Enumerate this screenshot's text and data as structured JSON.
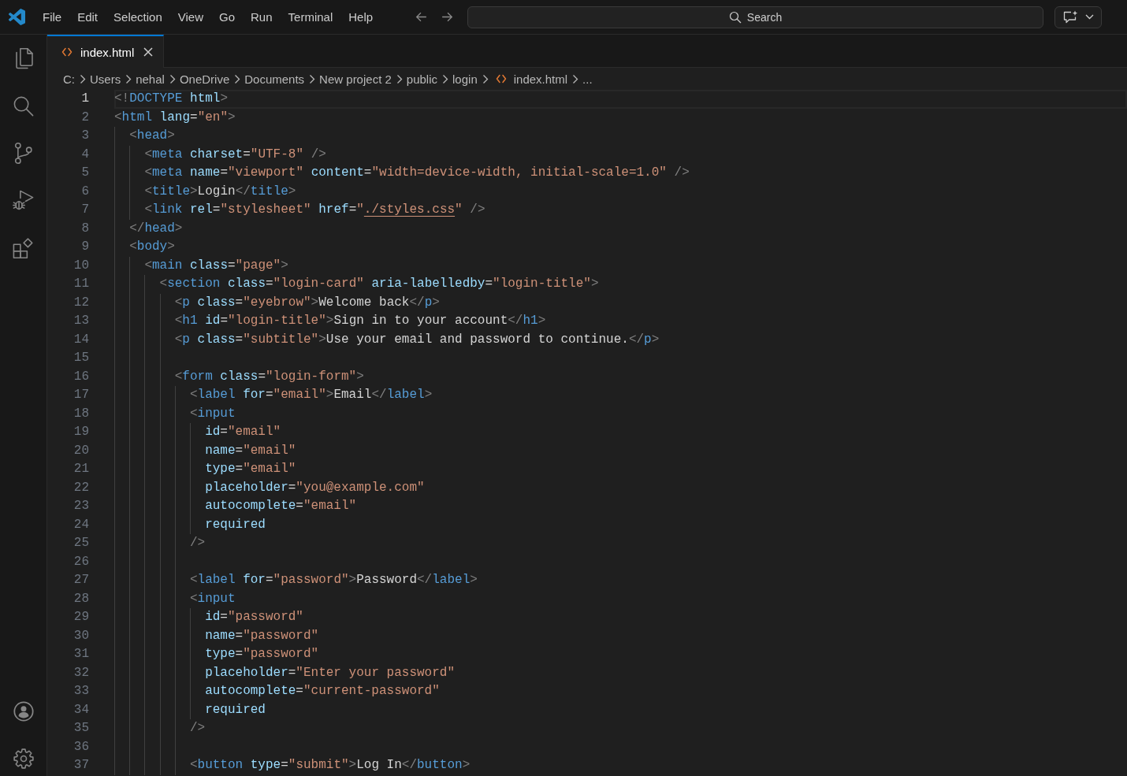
{
  "title_bar": {
    "menu": [
      "File",
      "Edit",
      "Selection",
      "View",
      "Go",
      "Run",
      "Terminal",
      "Help"
    ],
    "command_center": {
      "label": "Search"
    }
  },
  "tabs": [
    {
      "label": "index.html",
      "selected": true
    }
  ],
  "breadcrumb": [
    {
      "label": "C:",
      "kind": "folder"
    },
    {
      "label": "Users",
      "kind": "folder"
    },
    {
      "label": "nehal",
      "kind": "folder"
    },
    {
      "label": "OneDrive",
      "kind": "folder"
    },
    {
      "label": "Documents",
      "kind": "folder"
    },
    {
      "label": "New project 2",
      "kind": "folder"
    },
    {
      "label": "public",
      "kind": "folder"
    },
    {
      "label": "login",
      "kind": "folder"
    },
    {
      "label": "index.html",
      "kind": "file"
    },
    {
      "label": "...",
      "kind": "more"
    }
  ],
  "editor": {
    "lines": [
      {
        "number": "1",
        "current": true,
        "tokens": [
          {
            "kind": "punct",
            "text": "<!"
          },
          {
            "kind": "tag",
            "text": "DOCTYPE"
          },
          {
            "kind": "attr",
            "text": " html"
          },
          {
            "kind": "punct",
            "text": ">"
          }
        ]
      },
      {
        "number": "2",
        "current": false,
        "tokens": [
          {
            "kind": "punct",
            "text": "<"
          },
          {
            "kind": "tag",
            "text": "html"
          },
          {
            "kind": "attr",
            "text": " lang"
          },
          {
            "kind": "op",
            "text": "="
          },
          {
            "kind": "string",
            "text": "\"en\""
          },
          {
            "kind": "punct",
            "text": ">"
          }
        ],
        "children": [
          {
            "number": "3",
            "current": false,
            "tokens": [
              {
                "kind": "punct",
                "text": "<"
              },
              {
                "kind": "tag",
                "text": "head"
              },
              {
                "kind": "punct",
                "text": ">"
              }
            ],
            "children": [
              {
                "number": "4",
                "current": false,
                "tokens": [
                  {
                    "kind": "punct",
                    "text": "<"
                  },
                  {
                    "kind": "tag",
                    "text": "meta"
                  },
                  {
                    "kind": "attr",
                    "text": " charset"
                  },
                  {
                    "kind": "op",
                    "text": "="
                  },
                  {
                    "kind": "string",
                    "text": "\"UTF-8\""
                  },
                  {
                    "kind": "punct",
                    "text": " />"
                  }
                ]
              },
              {
                "number": "5",
                "current": false,
                "tokens": [
                  {
                    "kind": "punct",
                    "text": "<"
                  },
                  {
                    "kind": "tag",
                    "text": "meta"
                  },
                  {
                    "kind": "attr",
                    "text": " name"
                  },
                  {
                    "kind": "op",
                    "text": "="
                  },
                  {
                    "kind": "string",
                    "text": "\"viewport\""
                  },
                  {
                    "kind": "attr",
                    "text": " content"
                  },
                  {
                    "kind": "op",
                    "text": "="
                  },
                  {
                    "kind": "string",
                    "text": "\"width=device-width, initial-scale=1.0\""
                  },
                  {
                    "kind": "punct",
                    "text": " />"
                  }
                ]
              },
              {
                "number": "6",
                "current": false,
                "tokens": [
                  {
                    "kind": "punct",
                    "text": "<"
                  },
                  {
                    "kind": "tag",
                    "text": "title"
                  },
                  {
                    "kind": "punct",
                    "text": ">"
                  },
                  {
                    "kind": "text",
                    "text": "Login"
                  },
                  {
                    "kind": "punct",
                    "text": "</"
                  },
                  {
                    "kind": "tag",
                    "text": "title"
                  },
                  {
                    "kind": "punct",
                    "text": ">"
                  }
                ]
              },
              {
                "number": "7",
                "current": false,
                "tokens": [
                  {
                    "kind": "punct",
                    "text": "<"
                  },
                  {
                    "kind": "tag",
                    "text": "link"
                  },
                  {
                    "kind": "attr",
                    "text": " rel"
                  },
                  {
                    "kind": "op",
                    "text": "="
                  },
                  {
                    "kind": "string",
                    "text": "\"stylesheet\""
                  },
                  {
                    "kind": "attr",
                    "text": " href"
                  },
                  {
                    "kind": "op",
                    "text": "="
                  },
                  {
                    "kind": "string",
                    "text": "\""
                  },
                  {
                    "kind": "link",
                    "text": "./styles.css"
                  },
                  {
                    "kind": "string",
                    "text": "\""
                  },
                  {
                    "kind": "punct",
                    "text": " />"
                  }
                ]
              }
            ]
          },
          {
            "number": "8",
            "current": false,
            "tokens": [
              {
                "kind": "punct",
                "text": "</"
              },
              {
                "kind": "tag",
                "text": "head"
              },
              {
                "kind": "punct",
                "text": ">"
              }
            ]
          },
          {
            "number": "9",
            "current": false,
            "tokens": [
              {
                "kind": "punct",
                "text": "<"
              },
              {
                "kind": "tag",
                "text": "body"
              },
              {
                "kind": "punct",
                "text": ">"
              }
            ],
            "children": [
              {
                "number": "10",
                "current": false,
                "tokens": [
                  {
                    "kind": "punct",
                    "text": "<"
                  },
                  {
                    "kind": "tag",
                    "text": "main"
                  },
                  {
                    "kind": "attr",
                    "text": " class"
                  },
                  {
                    "kind": "op",
                    "text": "="
                  },
                  {
                    "kind": "string",
                    "text": "\"page\""
                  },
                  {
                    "kind": "punct",
                    "text": ">"
                  }
                ],
                "children": [
                  {
                    "number": "11",
                    "current": false,
                    "tokens": [
                      {
                        "kind": "punct",
                        "text": "<"
                      },
                      {
                        "kind": "tag",
                        "text": "section"
                      },
                      {
                        "kind": "attr",
                        "text": " class"
                      },
                      {
                        "kind": "op",
                        "text": "="
                      },
                      {
                        "kind": "string",
                        "text": "\"login-card\""
                      },
                      {
                        "kind": "attr",
                        "text": " aria-labelledby"
                      },
                      {
                        "kind": "op",
                        "text": "="
                      },
                      {
                        "kind": "string",
                        "text": "\"login-title\""
                      },
                      {
                        "kind": "punct",
                        "text": ">"
                      }
                    ],
                    "children": [
                      {
                        "number": "12",
                        "current": false,
                        "tokens": [
                          {
                            "kind": "punct",
                            "text": "<"
                          },
                          {
                            "kind": "tag",
                            "text": "p"
                          },
                          {
                            "kind": "attr",
                            "text": " class"
                          },
                          {
                            "kind": "op",
                            "text": "="
                          },
                          {
                            "kind": "string",
                            "text": "\"eyebrow\""
                          },
                          {
                            "kind": "punct",
                            "text": ">"
                          },
                          {
                            "kind": "text",
                            "text": "Welcome back"
                          },
                          {
                            "kind": "punct",
                            "text": "</"
                          },
                          {
                            "kind": "tag",
                            "text": "p"
                          },
                          {
                            "kind": "punct",
                            "text": ">"
                          }
                        ]
                      },
                      {
                        "number": "13",
                        "current": false,
                        "tokens": [
                          {
                            "kind": "punct",
                            "text": "<"
                          },
                          {
                            "kind": "tag",
                            "text": "h1"
                          },
                          {
                            "kind": "attr",
                            "text": " id"
                          },
                          {
                            "kind": "op",
                            "text": "="
                          },
                          {
                            "kind": "string",
                            "text": "\"login-title\""
                          },
                          {
                            "kind": "punct",
                            "text": ">"
                          },
                          {
                            "kind": "text",
                            "text": "Sign in to your account"
                          },
                          {
                            "kind": "punct",
                            "text": "</"
                          },
                          {
                            "kind": "tag",
                            "text": "h1"
                          },
                          {
                            "kind": "punct",
                            "text": ">"
                          }
                        ]
                      },
                      {
                        "number": "14",
                        "current": false,
                        "tokens": [
                          {
                            "kind": "punct",
                            "text": "<"
                          },
                          {
                            "kind": "tag",
                            "text": "p"
                          },
                          {
                            "kind": "attr",
                            "text": " class"
                          },
                          {
                            "kind": "op",
                            "text": "="
                          },
                          {
                            "kind": "string",
                            "text": "\"subtitle\""
                          },
                          {
                            "kind": "punct",
                            "text": ">"
                          },
                          {
                            "kind": "text",
                            "text": "Use your email and password to continue."
                          },
                          {
                            "kind": "punct",
                            "text": "</"
                          },
                          {
                            "kind": "tag",
                            "text": "p"
                          },
                          {
                            "kind": "punct",
                            "text": ">"
                          }
                        ]
                      },
                      {
                        "number": "15",
                        "current": false
                      },
                      {
                        "number": "16",
                        "current": false,
                        "tokens": [
                          {
                            "kind": "punct",
                            "text": "<"
                          },
                          {
                            "kind": "tag",
                            "text": "form"
                          },
                          {
                            "kind": "attr",
                            "text": " class"
                          },
                          {
                            "kind": "op",
                            "text": "="
                          },
                          {
                            "kind": "string",
                            "text": "\"login-form\""
                          },
                          {
                            "kind": "punct",
                            "text": ">"
                          }
                        ],
                        "children": [
                          {
                            "number": "17",
                            "current": false,
                            "tokens": [
                              {
                                "kind": "punct",
                                "text": "<"
                              },
                              {
                                "kind": "tag",
                                "text": "label"
                              },
                              {
                                "kind": "attr",
                                "text": " for"
                              },
                              {
                                "kind": "op",
                                "text": "="
                              },
                              {
                                "kind": "string",
                                "text": "\"email\""
                              },
                              {
                                "kind": "punct",
                                "text": ">"
                              },
                              {
                                "kind": "text",
                                "text": "Email"
                              },
                              {
                                "kind": "punct",
                                "text": "</"
                              },
                              {
                                "kind": "tag",
                                "text": "label"
                              },
                              {
                                "kind": "punct",
                                "text": ">"
                              }
                            ]
                          },
                          {
                            "number": "18",
                            "current": false,
                            "tokens": [
                              {
                                "kind": "punct",
                                "text": "<"
                              },
                              {
                                "kind": "tag",
                                "text": "input"
                              }
                            ],
                            "children": [
                              {
                                "number": "19",
                                "current": false,
                                "tokens": [
                                  {
                                    "kind": "attr",
                                    "text": "id"
                                  },
                                  {
                                    "kind": "op",
                                    "text": "="
                                  },
                                  {
                                    "kind": "string",
                                    "text": "\"email\""
                                  }
                                ]
                              },
                              {
                                "number": "20",
                                "current": false,
                                "tokens": [
                                  {
                                    "kind": "attr",
                                    "text": "name"
                                  },
                                  {
                                    "kind": "op",
                                    "text": "="
                                  },
                                  {
                                    "kind": "string",
                                    "text": "\"email\""
                                  }
                                ]
                              },
                              {
                                "number": "21",
                                "current": false,
                                "tokens": [
                                  {
                                    "kind": "attr",
                                    "text": "type"
                                  },
                                  {
                                    "kind": "op",
                                    "text": "="
                                  },
                                  {
                                    "kind": "string",
                                    "text": "\"email\""
                                  }
                                ]
                              },
                              {
                                "number": "22",
                                "current": false,
                                "tokens": [
                                  {
                                    "kind": "attr",
                                    "text": "placeholder"
                                  },
                                  {
                                    "kind": "op",
                                    "text": "="
                                  },
                                  {
                                    "kind": "string",
                                    "text": "\"you@example.com\""
                                  }
                                ]
                              },
                              {
                                "number": "23",
                                "current": false,
                                "tokens": [
                                  {
                                    "kind": "attr",
                                    "text": "autocomplete"
                                  },
                                  {
                                    "kind": "op",
                                    "text": "="
                                  },
                                  {
                                    "kind": "string",
                                    "text": "\"email\""
                                  }
                                ]
                              },
                              {
                                "number": "24",
                                "current": false,
                                "tokens": [
                                  {
                                    "kind": "attr",
                                    "text": "required"
                                  }
                                ]
                              }
                            ]
                          },
                          {
                            "number": "25",
                            "current": false,
                            "tokens": [
                              {
                                "kind": "punct",
                                "text": "/>"
                              }
                            ]
                          },
                          {
                            "number": "26",
                            "current": false
                          },
                          {
                            "number": "27",
                            "current": false,
                            "tokens": [
                              {
                                "kind": "punct",
                                "text": "<"
                              },
                              {
                                "kind": "tag",
                                "text": "label"
                              },
                              {
                                "kind": "attr",
                                "text": " for"
                              },
                              {
                                "kind": "op",
                                "text": "="
                              },
                              {
                                "kind": "string",
                                "text": "\"password\""
                              },
                              {
                                "kind": "punct",
                                "text": ">"
                              },
                              {
                                "kind": "text",
                                "text": "Password"
                              },
                              {
                                "kind": "punct",
                                "text": "</"
                              },
                              {
                                "kind": "tag",
                                "text": "label"
                              },
                              {
                                "kind": "punct",
                                "text": ">"
                              }
                            ]
                          },
                          {
                            "number": "28",
                            "current": false,
                            "tokens": [
                              {
                                "kind": "punct",
                                "text": "<"
                              },
                              {
                                "kind": "tag",
                                "text": "input"
                              }
                            ],
                            "children": [
                              {
                                "number": "29",
                                "current": false,
                                "tokens": [
                                  {
                                    "kind": "attr",
                                    "text": "id"
                                  },
                                  {
                                    "kind": "op",
                                    "text": "="
                                  },
                                  {
                                    "kind": "string",
                                    "text": "\"password\""
                                  }
                                ]
                              },
                              {
                                "number": "30",
                                "current": false,
                                "tokens": [
                                  {
                                    "kind": "attr",
                                    "text": "name"
                                  },
                                  {
                                    "kind": "op",
                                    "text": "="
                                  },
                                  {
                                    "kind": "string",
                                    "text": "\"password\""
                                  }
                                ]
                              },
                              {
                                "number": "31",
                                "current": false,
                                "tokens": [
                                  {
                                    "kind": "attr",
                                    "text": "type"
                                  },
                                  {
                                    "kind": "op",
                                    "text": "="
                                  },
                                  {
                                    "kind": "string",
                                    "text": "\"password\""
                                  }
                                ]
                              },
                              {
                                "number": "32",
                                "current": false,
                                "tokens": [
                                  {
                                    "kind": "attr",
                                    "text": "placeholder"
                                  },
                                  {
                                    "kind": "op",
                                    "text": "="
                                  },
                                  {
                                    "kind": "string",
                                    "text": "\"Enter your password\""
                                  }
                                ]
                              },
                              {
                                "number": "33",
                                "current": false,
                                "tokens": [
                                  {
                                    "kind": "attr",
                                    "text": "autocomplete"
                                  },
                                  {
                                    "kind": "op",
                                    "text": "="
                                  },
                                  {
                                    "kind": "string",
                                    "text": "\"current-password\""
                                  }
                                ]
                              },
                              {
                                "number": "34",
                                "current": false,
                                "tokens": [
                                  {
                                    "kind": "attr",
                                    "text": "required"
                                  }
                                ]
                              }
                            ]
                          },
                          {
                            "number": "35",
                            "current": false,
                            "tokens": [
                              {
                                "kind": "punct",
                                "text": "/>"
                              }
                            ]
                          },
                          {
                            "number": "36",
                            "current": false
                          },
                          {
                            "number": "37",
                            "current": false,
                            "tokens": [
                              {
                                "kind": "punct",
                                "text": "<"
                              },
                              {
                                "kind": "tag",
                                "text": "button"
                              },
                              {
                                "kind": "attr",
                                "text": " type"
                              },
                              {
                                "kind": "op",
                                "text": "="
                              },
                              {
                                "kind": "string",
                                "text": "\"submit\""
                              },
                              {
                                "kind": "punct",
                                "text": ">"
                              },
                              {
                                "kind": "text",
                                "text": "Log In"
                              },
                              {
                                "kind": "punct",
                                "text": "</"
                              },
                              {
                                "kind": "tag",
                                "text": "button"
                              },
                              {
                                "kind": "punct",
                                "text": ">"
                              }
                            ]
                          }
                        ]
                      }
                    ]
                  }
                ]
              }
            ]
          }
        ]
      }
    ]
  }
}
